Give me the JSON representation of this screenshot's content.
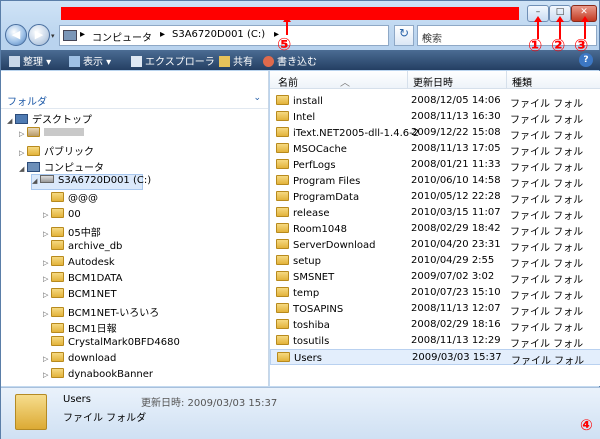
{
  "window": {
    "min_glyph": "–",
    "max_glyph": "□",
    "close_glyph": "✕"
  },
  "annotations": {
    "minimize": "①",
    "maximize": "②",
    "close": "③",
    "resize": "④",
    "titlebar": "⑤"
  },
  "address_bar": {
    "separator": "▸",
    "crumb_1": "コンピュータ",
    "crumb_2": "S3A6720D001 (C:)",
    "dropdown": "▾",
    "refresh": "↻"
  },
  "search": {
    "placeholder": "検索",
    "icon": "⌕"
  },
  "toolbar": {
    "organize": "整理",
    "views": "表示",
    "explorer": "エクスプローラ",
    "share": "共有",
    "burn": "書き込む",
    "help": "?"
  },
  "left_pane": {
    "header": "フォルダ",
    "tree": [
      {
        "label": "デスクトップ",
        "kind": "desktop",
        "expander": "◢"
      },
      {
        "label": "",
        "kind": "user",
        "expander": "▷"
      },
      {
        "label": "パブリック",
        "kind": "folder",
        "expander": "▷"
      },
      {
        "label": "コンピュータ",
        "kind": "computer",
        "expander": "◢"
      },
      {
        "label": "S3A6720D001 (C:)",
        "kind": "drive",
        "expander": "◢"
      },
      {
        "label": "@@@",
        "kind": "folder",
        "expander": ""
      },
      {
        "label": "00",
        "kind": "folder",
        "expander": "▷"
      },
      {
        "label": "05中部",
        "kind": "folder",
        "expander": "▷"
      },
      {
        "label": "archive_db",
        "kind": "folder",
        "expander": ""
      },
      {
        "label": "Autodesk",
        "kind": "folder",
        "expander": "▷"
      },
      {
        "label": "BCM1DATA",
        "kind": "folder",
        "expander": "▷"
      },
      {
        "label": "BCM1NET",
        "kind": "folder",
        "expander": "▷"
      },
      {
        "label": "BCM1NET-いろいろ",
        "kind": "folder",
        "expander": "▷"
      },
      {
        "label": "BCM1日報",
        "kind": "folder",
        "expander": ""
      },
      {
        "label": "CrystalMark0BFD4680",
        "kind": "folder",
        "expander": ""
      },
      {
        "label": "download",
        "kind": "folder",
        "expander": "▷"
      },
      {
        "label": "dynabookBanner",
        "kind": "folder",
        "expander": "▷"
      }
    ]
  },
  "right_pane": {
    "columns": {
      "name": "名前",
      "date": "更新日時",
      "type": "種類"
    },
    "rows": [
      {
        "name": "install",
        "date": "2008/12/05 14:06",
        "type": "ファイル フォル"
      },
      {
        "name": "Intel",
        "date": "2008/11/13 16:30",
        "type": "ファイル フォル"
      },
      {
        "name": "iText.NET2005-dll-1.4.6-2",
        "date": "2009/12/22 15:08",
        "type": "ファイル フォル"
      },
      {
        "name": "MSOCache",
        "date": "2008/11/13 17:05",
        "type": "ファイル フォル"
      },
      {
        "name": "PerfLogs",
        "date": "2008/01/21 11:33",
        "type": "ファイル フォル"
      },
      {
        "name": "Program Files",
        "date": "2010/06/10 14:58",
        "type": "ファイル フォル"
      },
      {
        "name": "ProgramData",
        "date": "2010/05/12 22:28",
        "type": "ファイル フォル"
      },
      {
        "name": "release",
        "date": "2010/03/15 11:07",
        "type": "ファイル フォル"
      },
      {
        "name": "Room1048",
        "date": "2008/02/29 18:42",
        "type": "ファイル フォル"
      },
      {
        "name": "ServerDownload",
        "date": "2010/04/20 23:31",
        "type": "ファイル フォル"
      },
      {
        "name": "setup",
        "date": "2010/04/29 2:55",
        "type": "ファイル フォル"
      },
      {
        "name": "SMSNET",
        "date": "2009/07/02 3:02",
        "type": "ファイル フォル"
      },
      {
        "name": "temp",
        "date": "2010/07/23 15:10",
        "type": "ファイル フォル"
      },
      {
        "name": "TOSAPINS",
        "date": "2008/11/13 12:07",
        "type": "ファイル フォル"
      },
      {
        "name": "toshiba",
        "date": "2008/02/29 18:16",
        "type": "ファイル フォル"
      },
      {
        "name": "tosutils",
        "date": "2008/11/13 12:29",
        "type": "ファイル フォル"
      },
      {
        "name": "Users",
        "date": "2009/03/03 15:37",
        "type": "ファイル フォル"
      }
    ]
  },
  "details": {
    "name": "Users",
    "date_label": "更新日時: 2009/03/03 15:37",
    "type": "ファイル フォルダ"
  },
  "colors": {
    "annotation": "#ff0000",
    "toolbar": "#243f63",
    "selection": "#dbe9fb"
  }
}
